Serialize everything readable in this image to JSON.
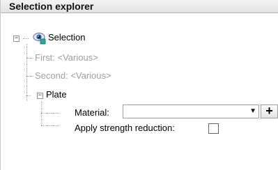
{
  "panel": {
    "title": "Selection explorer"
  },
  "tree": {
    "selection": {
      "label": "Selection",
      "expander": "−",
      "icon": "eye-selection-icon",
      "first_label": "First: <Various>",
      "second_label": "Second: <Various>"
    },
    "plate": {
      "label": "Plate",
      "expander": "−",
      "material_label": "Material:",
      "material_value": "",
      "add_button": "+",
      "strength_label": "Apply strength reduction:",
      "strength_checked": false
    }
  },
  "colors": {
    "disabled_text": "#a0a0a0",
    "checkbox_border": "#2e6fb8"
  }
}
